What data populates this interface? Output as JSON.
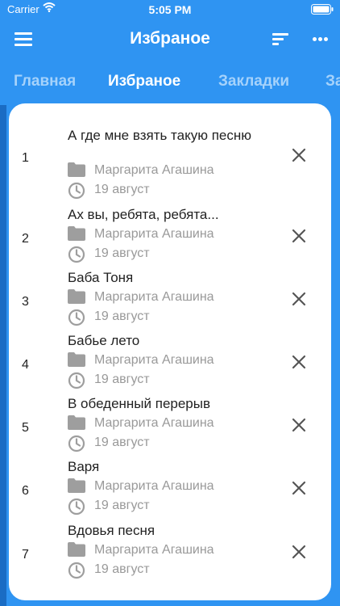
{
  "status": {
    "carrier": "Carrier",
    "time": "5:05 PM"
  },
  "header": {
    "title": "Избраное"
  },
  "tabs": [
    {
      "label": "Главная"
    },
    {
      "label": "Избраное"
    },
    {
      "label": "Закладки"
    },
    {
      "label": "За"
    }
  ],
  "items": [
    {
      "num": "1",
      "title": "А где мне взять такую песню",
      "author": "Маргарита Агашина",
      "date": "19 август"
    },
    {
      "num": "2",
      "title": "Ах вы, ребята, ребята...",
      "author": "Маргарита Агашина",
      "date": "19 август"
    },
    {
      "num": "3",
      "title": "Баба Тоня",
      "author": "Маргарита Агашина",
      "date": "19 август"
    },
    {
      "num": "4",
      "title": "Бабье лето",
      "author": "Маргарита Агашина",
      "date": "19 август"
    },
    {
      "num": "5",
      "title": "В обеденный перерыв",
      "author": "Маргарита Агашина",
      "date": "19 август"
    },
    {
      "num": "6",
      "title": "Варя",
      "author": "Маргарита Агашина",
      "date": "19 август"
    },
    {
      "num": "7",
      "title": "Вдовья песня",
      "author": "Маргарита Агашина",
      "date": "19 август"
    }
  ],
  "colors": {
    "brand": "#2f94f2",
    "card": "#ffffff",
    "muted": "#999999",
    "text": "#222222"
  },
  "icons": {
    "menu": "hamburger-icon",
    "sort": "sort-icon",
    "more": "more-icon",
    "folder": "folder-icon",
    "clock": "clock-icon",
    "remove": "close-icon"
  }
}
